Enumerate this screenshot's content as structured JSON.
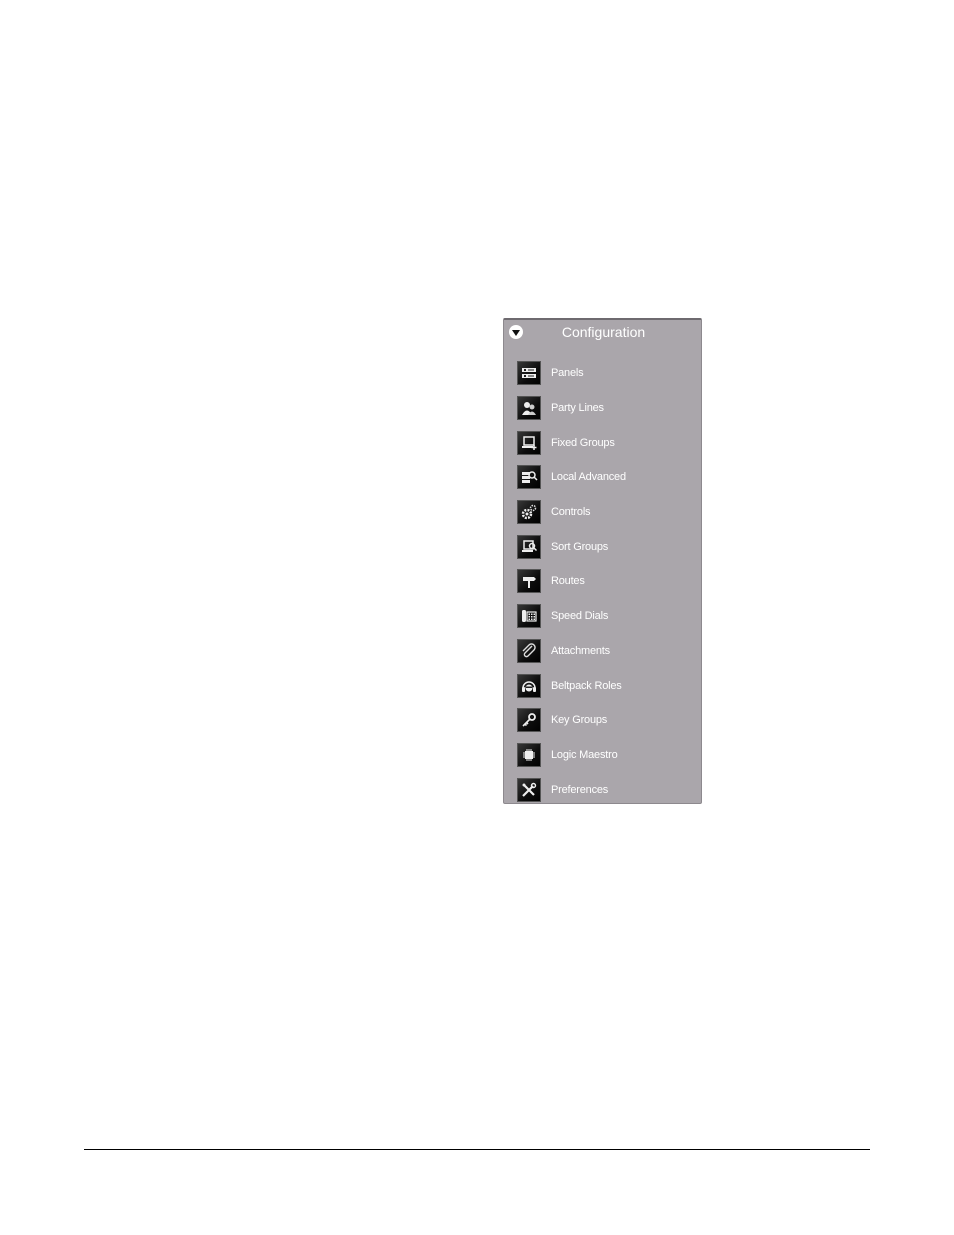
{
  "panel": {
    "title": "Configuration",
    "collapse_icon": "chevron-down-circle-icon",
    "items": [
      {
        "label": "Panels",
        "icon": "panels-icon"
      },
      {
        "label": "Party Lines",
        "icon": "party-lines-icon"
      },
      {
        "label": "Fixed Groups",
        "icon": "fixed-groups-icon"
      },
      {
        "label": "Local Advanced",
        "icon": "local-advanced-icon"
      },
      {
        "label": "Controls",
        "icon": "controls-icon"
      },
      {
        "label": "Sort Groups",
        "icon": "sort-groups-icon"
      },
      {
        "label": "Routes",
        "icon": "routes-icon"
      },
      {
        "label": "Speed Dials",
        "icon": "speed-dials-icon"
      },
      {
        "label": "Attachments",
        "icon": "attachments-icon"
      },
      {
        "label": "Beltpack Roles",
        "icon": "beltpack-roles-icon"
      },
      {
        "label": "Key Groups",
        "icon": "key-groups-icon"
      },
      {
        "label": "Logic Maestro",
        "icon": "logic-maestro-icon"
      },
      {
        "label": "Preferences",
        "icon": "preferences-icon"
      }
    ]
  }
}
